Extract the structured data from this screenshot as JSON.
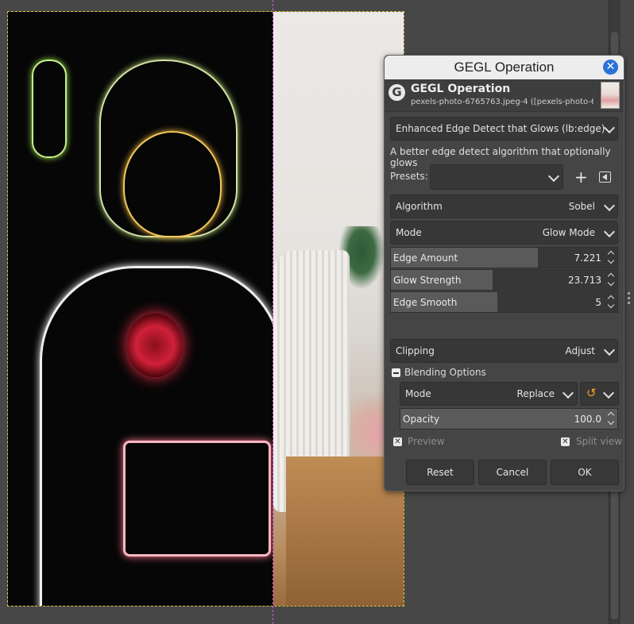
{
  "dialog": {
    "window_title": "GEGL Operation",
    "header_title": "GEGL Operation",
    "header_subtitle": "pexels-photo-6765763.jpeg-4 ([pexels-photo-6...",
    "operation": "Enhanced Edge Detect that Glows (lb:edge)",
    "description": "A better edge detect algorithm that optionally glows",
    "presets_label": "Presets:",
    "presets_value": "",
    "algorithm": {
      "label": "Algorithm",
      "value": "Sobel"
    },
    "mode": {
      "label": "Mode",
      "value": "Glow Mode"
    },
    "edge_amount": {
      "label": "Edge Amount",
      "value": "7.221",
      "fill_fraction": 0.65
    },
    "glow_strength": {
      "label": "Glow Strength",
      "value": "23.713",
      "fill_fraction": 0.45
    },
    "edge_smooth": {
      "label": "Edge Smooth",
      "value": "5",
      "fill_fraction": 0.47
    },
    "clipping": {
      "label": "Clipping",
      "value": "Adjust"
    },
    "blending": {
      "section_label": "Blending Options",
      "mode_label": "Mode",
      "mode_value": "Replace",
      "opacity_label": "Opacity",
      "opacity_value": "100.0",
      "opacity_fill_fraction": 1.0
    },
    "preview_label": "Preview",
    "split_view_label": "Split view",
    "buttons": {
      "reset": "Reset",
      "cancel": "Cancel",
      "ok": "OK"
    }
  },
  "colors": {
    "accent": "#2b72d8",
    "reset_icon": "#f0a020",
    "guide": "#d84fd0",
    "selection": "#d8c23a"
  }
}
